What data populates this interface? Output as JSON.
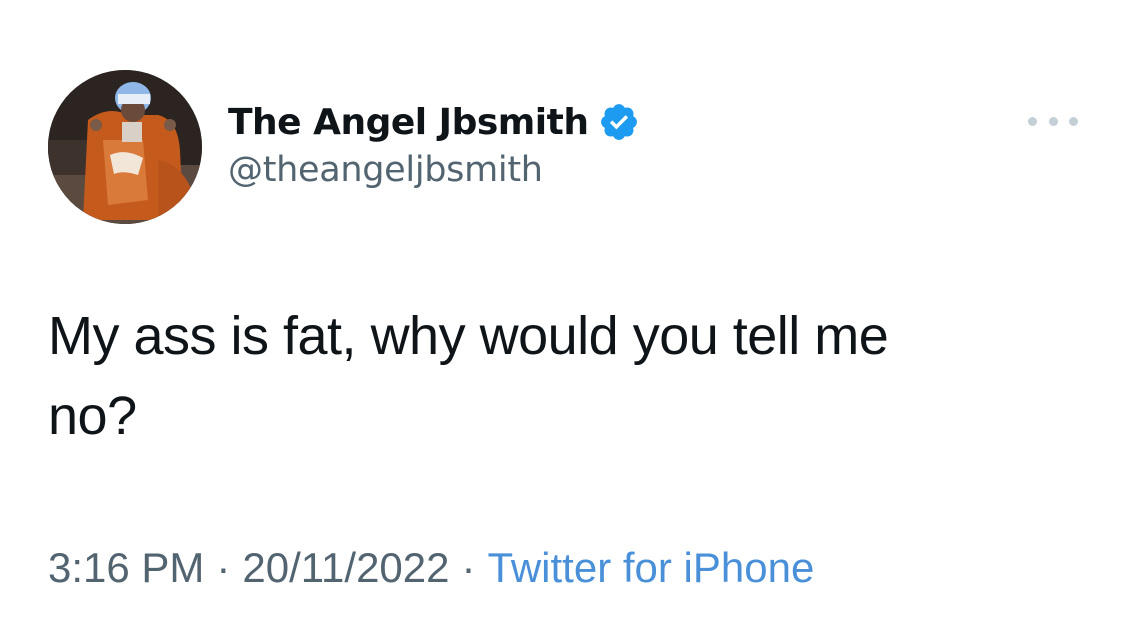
{
  "author": {
    "display_name": "The Angel Jbsmith",
    "handle": "@theangeljbsmith",
    "verified_icon": "verified-badge-icon",
    "avatar_icon": "profile-photo"
  },
  "menu": {
    "icon": "more-options-icon"
  },
  "tweet": {
    "text": "My ass is fat, why would you tell me\nno?"
  },
  "meta": {
    "time": "3:16 PM",
    "separator": "·",
    "date": "20/11/2022",
    "source": "Twitter for iPhone"
  },
  "colors": {
    "text": "#0f1419",
    "secondary": "#536471",
    "link": "#4a90d9",
    "verified": "#1d9bf0"
  }
}
